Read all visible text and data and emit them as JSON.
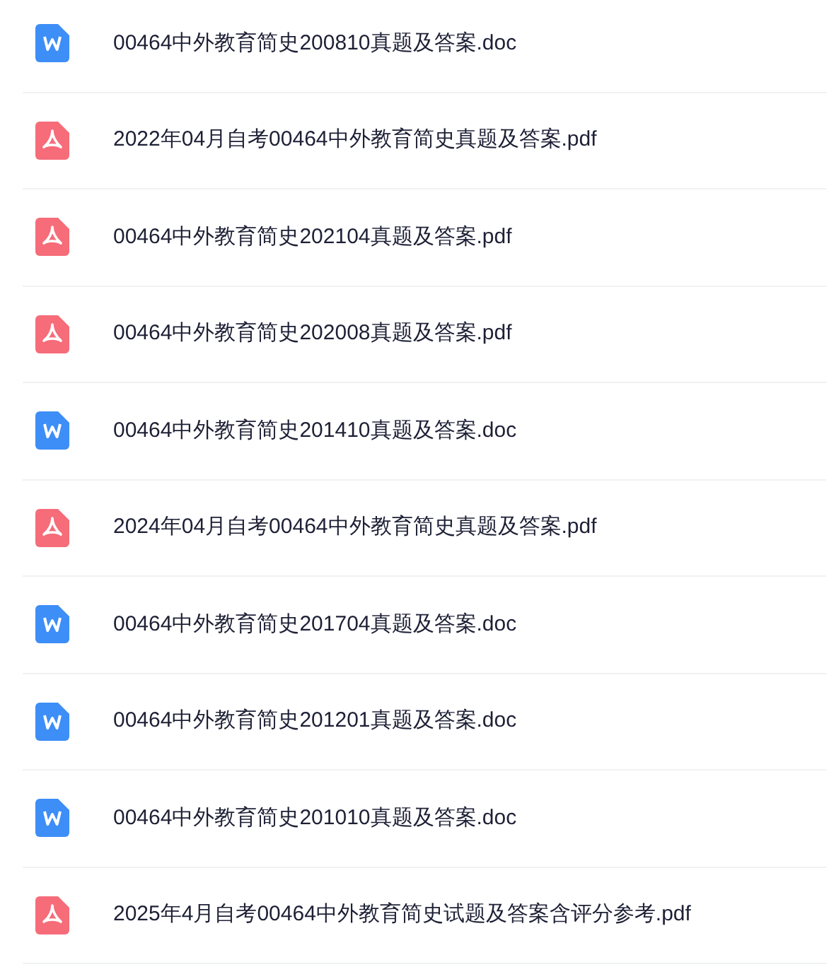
{
  "files": [
    {
      "kind": "doc",
      "name": "00464中外教育简史200810真题及答案.doc"
    },
    {
      "kind": "pdf",
      "name": "2022年04月自考00464中外教育简史真题及答案.pdf"
    },
    {
      "kind": "pdf",
      "name": "00464中外教育简史202104真题及答案.pdf"
    },
    {
      "kind": "pdf",
      "name": "00464中外教育简史202008真题及答案.pdf"
    },
    {
      "kind": "doc",
      "name": "00464中外教育简史201410真题及答案.doc"
    },
    {
      "kind": "pdf",
      "name": "2024年04月自考00464中外教育简史真题及答案.pdf"
    },
    {
      "kind": "doc",
      "name": "00464中外教育简史201704真题及答案.doc"
    },
    {
      "kind": "doc",
      "name": "00464中外教育简史201201真题及答案.doc"
    },
    {
      "kind": "doc",
      "name": "00464中外教育简史201010真题及答案.doc"
    },
    {
      "kind": "pdf",
      "name": "2025年4月自考00464中外教育简史试题及答案含评分参考.pdf"
    }
  ]
}
